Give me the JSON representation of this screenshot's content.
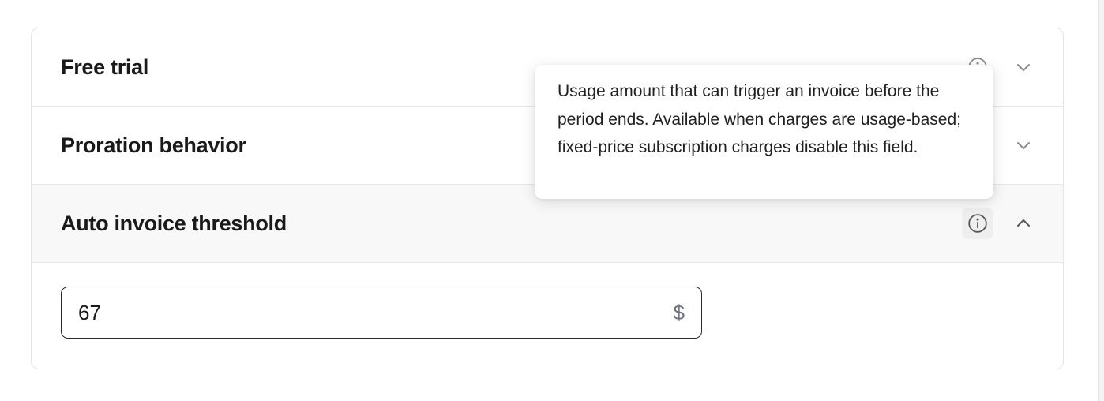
{
  "sections": [
    {
      "title": "Free trial",
      "expanded": false
    },
    {
      "title": "Proration behavior",
      "expanded": false
    },
    {
      "title": "Auto invoice threshold",
      "expanded": true
    }
  ],
  "threshold_field": {
    "value": "67",
    "currency_symbol": "$"
  },
  "tooltip": {
    "text": "Usage amount that can trigger an invoice before the period ends. Available when charges are usage-based; fixed-price subscription charges disable this field."
  },
  "icons": {
    "info": "info-icon",
    "collapsed": "chevron-down-icon",
    "expanded": "chevron-up-icon"
  },
  "colors": {
    "icon": "#8a8a8a",
    "open_header_bg": "#f8f8f8",
    "currency": "#6b7280"
  }
}
